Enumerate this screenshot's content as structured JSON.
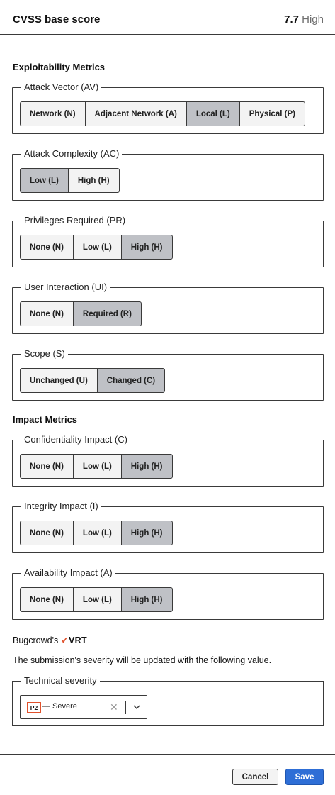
{
  "header": {
    "title": "CVSS base score",
    "score": "7.7",
    "severity_label": "High"
  },
  "exploitability": {
    "heading": "Exploitability Metrics",
    "metrics": [
      {
        "label": "Attack Vector (AV)",
        "options": [
          "Network (N)",
          "Adjacent Network (A)",
          "Local (L)",
          "Physical (P)"
        ],
        "selected": "Local (L)"
      },
      {
        "label": "Attack Complexity (AC)",
        "options": [
          "Low (L)",
          "High (H)"
        ],
        "selected": "Low (L)"
      },
      {
        "label": "Privileges Required (PR)",
        "options": [
          "None (N)",
          "Low (L)",
          "High (H)"
        ],
        "selected": "High (H)"
      },
      {
        "label": "User Interaction (UI)",
        "options": [
          "None (N)",
          "Required (R)"
        ],
        "selected": "Required (R)"
      },
      {
        "label": "Scope (S)",
        "options": [
          "Unchanged (U)",
          "Changed (C)"
        ],
        "selected": "Changed (C)"
      }
    ]
  },
  "impact": {
    "heading": "Impact Metrics",
    "metrics": [
      {
        "label": "Confidentiality Impact (C)",
        "options": [
          "None (N)",
          "Low (L)",
          "High (H)"
        ],
        "selected": "High (H)"
      },
      {
        "label": "Integrity Impact (I)",
        "options": [
          "None (N)",
          "Low (L)",
          "High (H)"
        ],
        "selected": "High (H)"
      },
      {
        "label": "Availability Impact (A)",
        "options": [
          "None (N)",
          "Low (L)",
          "High (H)"
        ],
        "selected": "High (H)"
      }
    ]
  },
  "vrt": {
    "prefix": "Bugcrowd's",
    "logo_text": "VRT",
    "note": "The submission's severity will be updated with the following value."
  },
  "technical_severity": {
    "label": "Technical severity",
    "badge": "P2",
    "value": "— Severe",
    "clear_icon": "close-icon",
    "dropdown_icon": "chevron-down-icon"
  },
  "footer": {
    "cancel_label": "Cancel",
    "save_label": "Save"
  },
  "colors": {
    "accent": "#2e6ed6",
    "selected_option": "#bfc1c6",
    "vrt_brand": "#e0512c"
  }
}
